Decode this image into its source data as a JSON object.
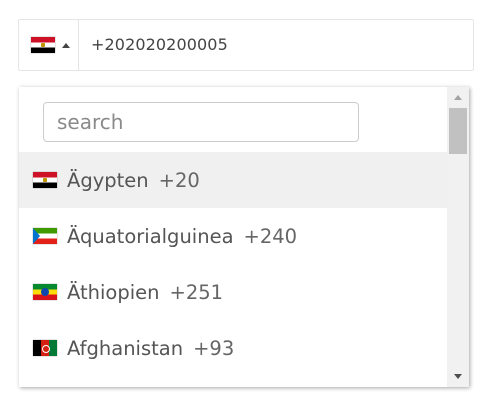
{
  "phone_input": {
    "selected_flag": "flag-egypt-icon",
    "value": "+202020200005"
  },
  "search": {
    "placeholder": "search"
  },
  "countries": [
    {
      "name": "Ägypten",
      "dial": "+20",
      "flag": "flag-egypt-icon",
      "selected": true
    },
    {
      "name": "Äquatorialguinea",
      "dial": "+240",
      "flag": "flag-equatorial-guinea-icon",
      "selected": false
    },
    {
      "name": "Äthiopien",
      "dial": "+251",
      "flag": "flag-ethiopia-icon",
      "selected": false
    },
    {
      "name": "Afghanistan",
      "dial": "+93",
      "flag": "flag-afghanistan-icon",
      "selected": false
    }
  ],
  "colors": {
    "selected_row_bg": "#f0f0f0",
    "border": "#e5e5e5",
    "text": "#555555"
  }
}
